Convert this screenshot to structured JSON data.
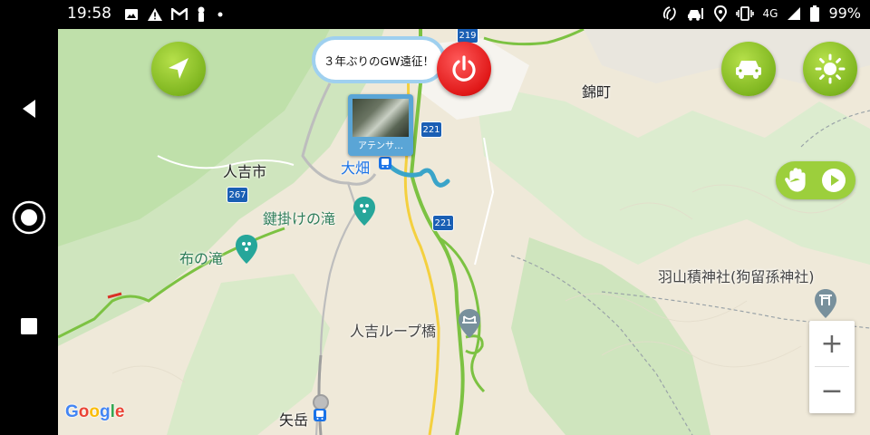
{
  "status_bar": {
    "time": "19:58",
    "left_icons": [
      "image-icon",
      "warning-icon",
      "gmail-icon",
      "flashlight-icon",
      "dot-icon"
    ],
    "right_icons": [
      "nfc-icon",
      "car-mode-icon",
      "location-icon",
      "vibrate-icon"
    ],
    "network": "4G",
    "battery": "99%"
  },
  "nav_bar": {
    "back": "back-icon",
    "home": "home-icon",
    "recents": "recents-icon"
  },
  "map": {
    "places": {
      "nishikimachi": "錦町",
      "hitoyoshi": "人吉市",
      "ohata": "大畑",
      "kagikake": "鍵掛けの滝",
      "nunonotaki": "布の滝",
      "hayama_shrine": "羽山積神社(狗留孫神社)",
      "loop_bridge": "人吉ループ橋",
      "yatake": "矢岳"
    },
    "road_signs": [
      "219",
      "221",
      "221",
      "267"
    ],
    "attribution": "Google"
  },
  "overlay": {
    "speech_bubble": "３年ぶりのGW遠征！",
    "photo_caption": "アテンサ…",
    "buttons": {
      "compass": "navigate-arrow-icon",
      "power": "power-icon",
      "car": "car-icon",
      "brightness": "sun-icon",
      "hand_play": "hand-play-icon"
    },
    "zoom": {
      "in": "+",
      "out": "−"
    }
  },
  "colors": {
    "accent_green": "#8cc63f",
    "power_red": "#e01818",
    "bubble_border": "#9fd0ef",
    "photo_frame": "#5aa5d6",
    "road_sign_blue": "#1a5fb4",
    "road_yellow": "#f4d03f",
    "road_green": "#7cc242"
  }
}
